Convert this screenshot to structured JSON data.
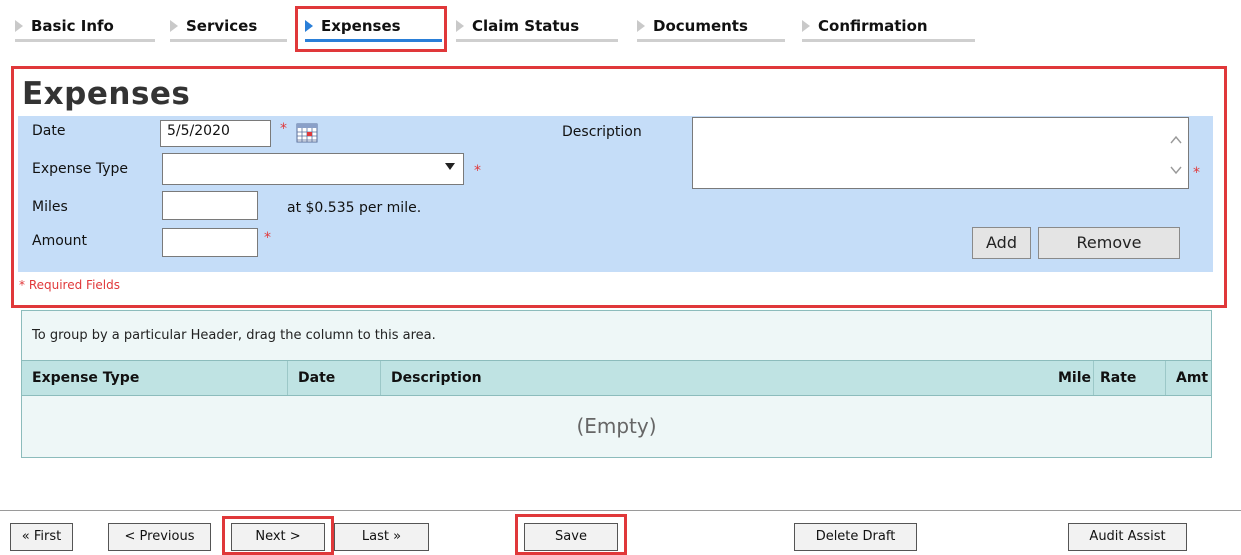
{
  "tabs": [
    {
      "label": "Basic Info",
      "active": false
    },
    {
      "label": "Services",
      "active": false
    },
    {
      "label": "Expenses",
      "active": true
    },
    {
      "label": "Claim Status",
      "active": false
    },
    {
      "label": "Documents",
      "active": false
    },
    {
      "label": "Confirmation",
      "active": false
    }
  ],
  "form": {
    "title": "Expenses",
    "date_label": "Date",
    "date_value": "5/5/2020",
    "expense_type_label": "Expense Type",
    "expense_type_value": "",
    "miles_label": "Miles",
    "miles_value": "",
    "miles_rate_text": "at $0.535 per mile.",
    "amount_label": "Amount",
    "amount_value": "",
    "description_label": "Description",
    "description_value": "",
    "required_marker": "*",
    "add_label": "Add",
    "remove_label": "Remove",
    "required_note": "* Required Fields"
  },
  "grid": {
    "group_hint": "To group by a particular Header, drag the column to this area.",
    "columns": [
      "Expense Type",
      "Date",
      "Description",
      "Mile",
      "Rate",
      "Amt"
    ],
    "empty_text": "(Empty)"
  },
  "footer": {
    "first": "« First",
    "previous": "< Previous",
    "next": "Next >",
    "last": "Last »",
    "save": "Save",
    "delete_draft": "Delete Draft",
    "audit_assist": "Audit Assist"
  },
  "colors": {
    "accent": "#2a7fd8",
    "highlight": "#e0383a",
    "form_bg": "#c5ddf8",
    "grid_header": "#bfe3e3"
  }
}
